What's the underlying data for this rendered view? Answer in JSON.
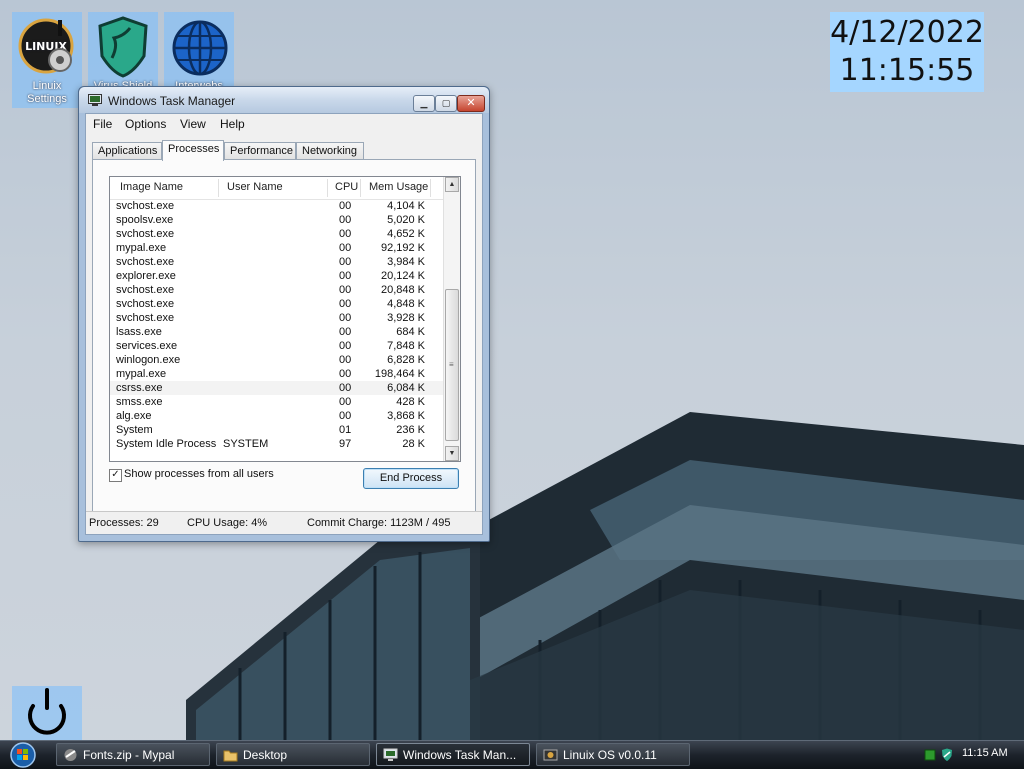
{
  "desktop": {
    "icons": [
      {
        "label": "Linuix Settings",
        "logo_text": "LINUIX"
      },
      {
        "label": "Virus Shield"
      },
      {
        "label": "Interwebs"
      }
    ],
    "clock": {
      "date": "4/12/2022",
      "time": "11:15:55"
    }
  },
  "taskmgr": {
    "title": "Windows Task Manager",
    "menu": [
      "File",
      "Options",
      "View",
      "Help"
    ],
    "tabs": [
      "Applications",
      "Processes",
      "Performance",
      "Networking"
    ],
    "active_tab": "Processes",
    "columns": [
      "Image Name",
      "User Name",
      "CPU",
      "Mem Usage"
    ],
    "rows": [
      {
        "name": "svchost.exe",
        "user": "",
        "cpu": "00",
        "mem": "4,104 K"
      },
      {
        "name": "spoolsv.exe",
        "user": "",
        "cpu": "00",
        "mem": "5,020 K"
      },
      {
        "name": "svchost.exe",
        "user": "",
        "cpu": "00",
        "mem": "4,652 K"
      },
      {
        "name": "mypal.exe",
        "user": "",
        "cpu": "00",
        "mem": "92,192 K"
      },
      {
        "name": "svchost.exe",
        "user": "",
        "cpu": "00",
        "mem": "3,984 K"
      },
      {
        "name": "explorer.exe",
        "user": "",
        "cpu": "00",
        "mem": "20,124 K"
      },
      {
        "name": "svchost.exe",
        "user": "",
        "cpu": "00",
        "mem": "20,848 K"
      },
      {
        "name": "svchost.exe",
        "user": "",
        "cpu": "00",
        "mem": "4,848 K"
      },
      {
        "name": "svchost.exe",
        "user": "",
        "cpu": "00",
        "mem": "3,928 K"
      },
      {
        "name": "lsass.exe",
        "user": "",
        "cpu": "00",
        "mem": "684 K"
      },
      {
        "name": "services.exe",
        "user": "",
        "cpu": "00",
        "mem": "7,848 K"
      },
      {
        "name": "winlogon.exe",
        "user": "",
        "cpu": "00",
        "mem": "6,828 K"
      },
      {
        "name": "mypal.exe",
        "user": "",
        "cpu": "00",
        "mem": "198,464 K"
      },
      {
        "name": "csrss.exe",
        "user": "",
        "cpu": "00",
        "mem": "6,084 K",
        "selected": true
      },
      {
        "name": "smss.exe",
        "user": "",
        "cpu": "00",
        "mem": "428 K"
      },
      {
        "name": "alg.exe",
        "user": "",
        "cpu": "00",
        "mem": "3,868 K"
      },
      {
        "name": "System",
        "user": "",
        "cpu": "01",
        "mem": "236 K"
      },
      {
        "name": "System Idle Process",
        "user": "SYSTEM",
        "cpu": "97",
        "mem": "28 K"
      }
    ],
    "show_all_users": {
      "label": "Show processes from all users",
      "checked": true,
      "mark": "✓"
    },
    "end_process_label": "End Process",
    "status": {
      "processes": "Processes: 29",
      "cpu": "CPU Usage: 4%",
      "commit": "Commit Charge: 1123M / 495"
    }
  },
  "taskbar": {
    "buttons": [
      {
        "label": "Fonts.zip - Mypal",
        "icon": "browser-icon"
      },
      {
        "label": "Desktop",
        "icon": "folder-icon"
      },
      {
        "label": "Windows Task Man...",
        "icon": "taskmgr-icon",
        "active": true
      },
      {
        "label": "Linuix OS v0.0.11",
        "icon": "linuix-icon"
      }
    ],
    "clock": "11:15 AM"
  },
  "colors": {
    "accent": "#a5d6ff",
    "selection": "#f3f3f3",
    "taskbar": "#1d232b"
  }
}
